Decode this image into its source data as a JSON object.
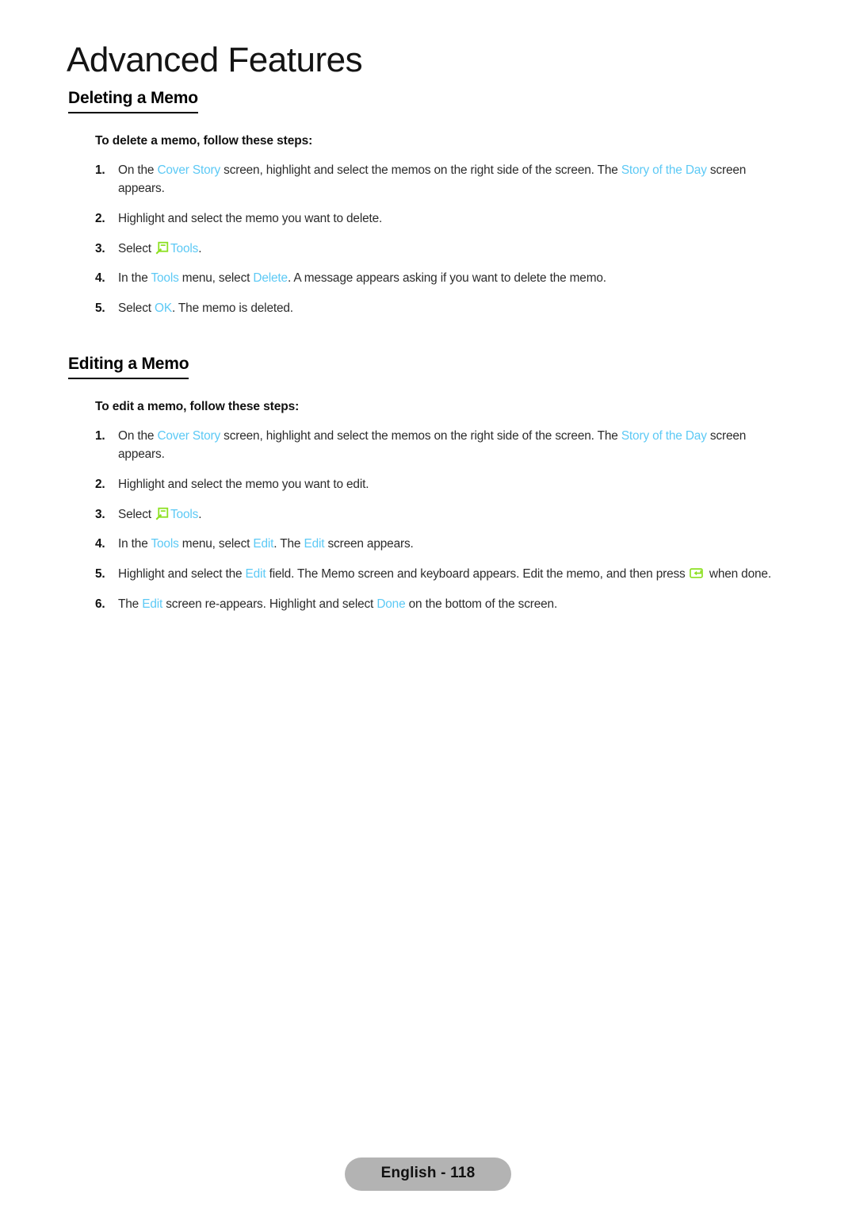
{
  "page": {
    "chapter_title": "Advanced Features",
    "footer_label": "English - 118",
    "link_color": "#5CC9F5",
    "icon_color": "#8CE020",
    "footer_pill_color": "#b3b3b3"
  },
  "sections": [
    {
      "heading": "Deleting a Memo",
      "lead": "To delete a memo, follow these steps:",
      "steps": [
        {
          "num": "1.",
          "parts": [
            {
              "t": "On the ",
              "k": "text"
            },
            {
              "t": "Cover Story",
              "k": "link"
            },
            {
              "t": " screen, highlight and select the memos on the right side of the screen. The ",
              "k": "text"
            },
            {
              "t": "Story of the Day",
              "k": "link"
            },
            {
              "t": " screen appears.",
              "k": "text"
            }
          ]
        },
        {
          "num": "2.",
          "parts": [
            {
              "t": "Highlight and select the memo you want to delete.",
              "k": "text"
            }
          ]
        },
        {
          "num": "3.",
          "parts": [
            {
              "t": "Select ",
              "k": "text"
            },
            {
              "t": "tools-icon",
              "k": "icon"
            },
            {
              "t": "Tools",
              "k": "link"
            },
            {
              "t": ".",
              "k": "text"
            }
          ]
        },
        {
          "num": "4.",
          "parts": [
            {
              "t": "In the ",
              "k": "text"
            },
            {
              "t": "Tools",
              "k": "link"
            },
            {
              "t": " menu, select ",
              "k": "text"
            },
            {
              "t": "Delete",
              "k": "link"
            },
            {
              "t": ". A message appears asking if you want to delete the memo.",
              "k": "text"
            }
          ]
        },
        {
          "num": "5.",
          "parts": [
            {
              "t": "Select ",
              "k": "text"
            },
            {
              "t": "OK",
              "k": "link"
            },
            {
              "t": ". The memo is deleted.",
              "k": "text"
            }
          ]
        }
      ]
    },
    {
      "heading": "Editing a Memo",
      "lead": "To edit a memo, follow these steps:",
      "steps": [
        {
          "num": "1.",
          "parts": [
            {
              "t": "On the ",
              "k": "text"
            },
            {
              "t": "Cover Story",
              "k": "link"
            },
            {
              "t": " screen, highlight and select the memos on the right side of the screen. The ",
              "k": "text"
            },
            {
              "t": "Story of the Day",
              "k": "link"
            },
            {
              "t": " screen appears.",
              "k": "text"
            }
          ]
        },
        {
          "num": "2.",
          "parts": [
            {
              "t": "Highlight and select the memo you want to edit.",
              "k": "text"
            }
          ]
        },
        {
          "num": "3.",
          "parts": [
            {
              "t": "Select ",
              "k": "text"
            },
            {
              "t": "tools-icon",
              "k": "icon"
            },
            {
              "t": "Tools",
              "k": "link"
            },
            {
              "t": ".",
              "k": "text"
            }
          ]
        },
        {
          "num": "4.",
          "parts": [
            {
              "t": "In the ",
              "k": "text"
            },
            {
              "t": "Tools",
              "k": "link"
            },
            {
              "t": " menu, select ",
              "k": "text"
            },
            {
              "t": "Edit",
              "k": "link"
            },
            {
              "t": ". The ",
              "k": "text"
            },
            {
              "t": "Edit",
              "k": "link"
            },
            {
              "t": " screen appears.",
              "k": "text"
            }
          ]
        },
        {
          "num": "5.",
          "parts": [
            {
              "t": "Highlight and select the ",
              "k": "text"
            },
            {
              "t": "Edit",
              "k": "link"
            },
            {
              "t": " field. The Memo screen and keyboard appears. Edit the memo, and then press ",
              "k": "text"
            },
            {
              "t": "enter-key-icon",
              "k": "icon"
            },
            {
              "t": " when done.",
              "k": "text"
            }
          ]
        },
        {
          "num": "6.",
          "parts": [
            {
              "t": "The ",
              "k": "text"
            },
            {
              "t": "Edit",
              "k": "link"
            },
            {
              "t": " screen re-appears. Highlight and select ",
              "k": "text"
            },
            {
              "t": "Done",
              "k": "link"
            },
            {
              "t": " on the bottom of the screen.",
              "k": "text"
            }
          ]
        }
      ]
    }
  ]
}
